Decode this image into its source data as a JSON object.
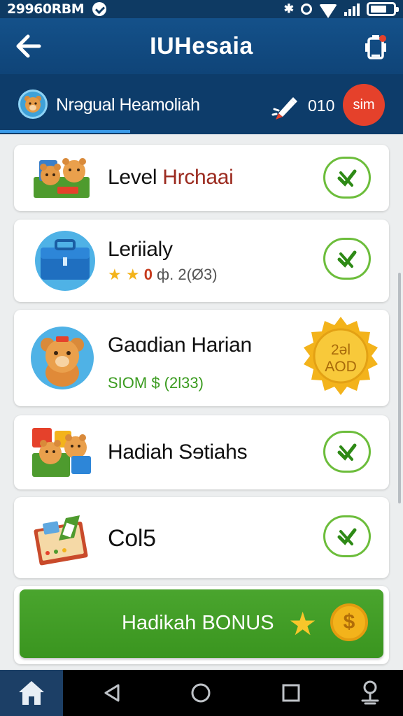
{
  "status_bar": {
    "time": "29960RBM",
    "bluetooth": "✱",
    "signal_bars": [
      6,
      10,
      14,
      18
    ],
    "icons": [
      "chat-icon",
      "bluetooth-icon",
      "circle-icon",
      "wifi-icon",
      "signal-icon",
      "battery-icon"
    ]
  },
  "header": {
    "title": "IUHesaia",
    "left_icon": "back-arrow-icon",
    "right_icon": "phone-battery-icon"
  },
  "profile": {
    "name": "Nrəgual Heamoliah",
    "coins": "010",
    "badge": "sim",
    "avatar_icon": "bear-avatar-icon",
    "action_icon": "pen-icon"
  },
  "rewards": [
    {
      "title": "Level ",
      "title_accent": "Hrchaai",
      "icon": "bears-basket-icon",
      "action_icon": "check-icon"
    },
    {
      "title": "Leriialy",
      "stars": "★ ★",
      "sub_accent": "0",
      "sub": " ф. 2(Ø3)",
      "icon": "toolbox-icon",
      "action_icon": "check-icon"
    },
    {
      "title": "Gaɑdian Harian",
      "sub": "SIOM $ (2l33)",
      "badge_line1": "2əl",
      "badge_line2": "AOD",
      "icon": "bear-icon",
      "badge_icon": "gold-seal-icon"
    },
    {
      "title": "Hadiah Sɘtiahs",
      "icon": "bears-gift-icon",
      "action_icon": "check-icon"
    },
    {
      "title": "Col5",
      "icon": "gift-box-icon",
      "action_icon": "check-icon"
    }
  ],
  "bonus": {
    "label": "Hadikah BONUS",
    "star": "★",
    "coin_symbol": "$"
  },
  "colors": {
    "header_bg": "#14518a",
    "profile_bg": "#0d3c6a",
    "accent_green": "#4aa52e",
    "badge_red": "#e5412b",
    "gold": "#f3b31b"
  },
  "nav": {
    "items": [
      "home-icon",
      "back-triangle-icon",
      "home-circle-icon",
      "recents-square-icon",
      "assistant-icon"
    ]
  }
}
